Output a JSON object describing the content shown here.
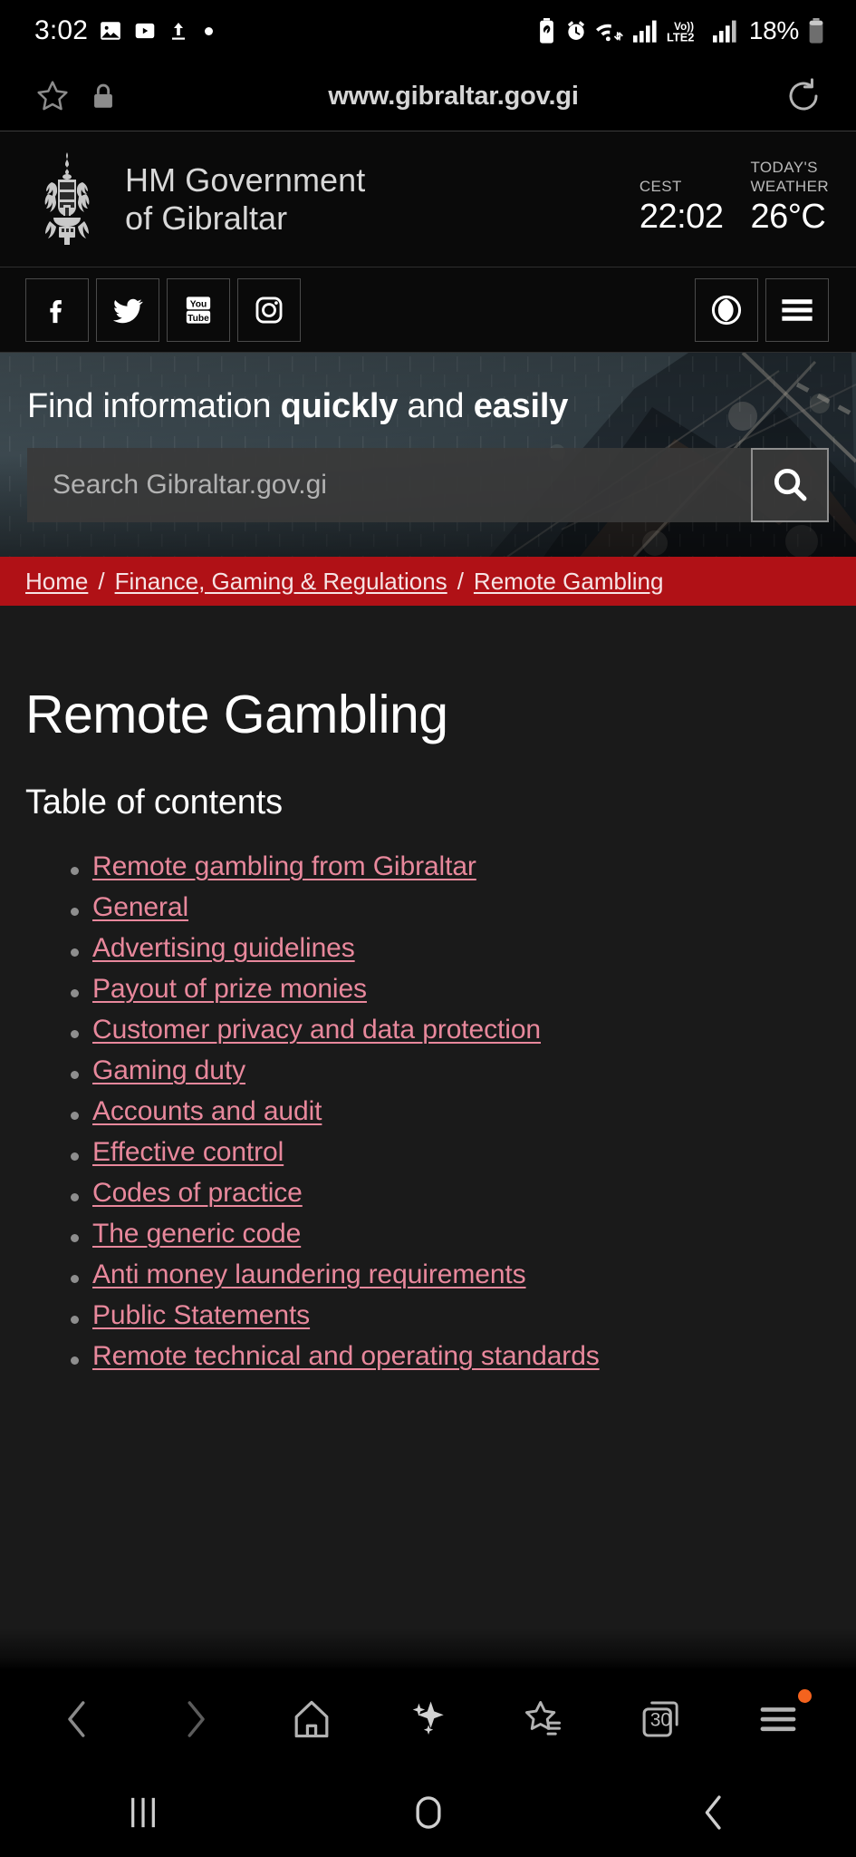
{
  "status_bar": {
    "clock": "3:02",
    "battery_percent": "18%",
    "network_label": "LTE2",
    "volte_label": "Vo))",
    "icons": [
      "photo-icon",
      "youtube-icon",
      "upload-icon",
      "status-dot",
      "battery-saver-icon",
      "alarm-icon",
      "wifi-icon",
      "signal-icon",
      "volte-icon",
      "signal2-icon",
      "battery-icon"
    ]
  },
  "browser": {
    "url": "www.gibraltar.gov.gi",
    "star_icon": "star-icon",
    "lock_icon": "lock-icon",
    "reload_icon": "reload-icon",
    "toolbar": {
      "back": "back-icon",
      "forward": "forward-icon",
      "home": "home-icon",
      "ai": "sparkle-icon",
      "bookmarks": "bookmarks-icon",
      "tabs_count": "30",
      "menu": "menu-icon",
      "menu_badge": true
    }
  },
  "android_nav": {
    "recents": "recents-icon",
    "home": "home-circle-icon",
    "back": "back-chevron-icon"
  },
  "site_header": {
    "crest": "gibraltar-coat-of-arms",
    "title_line1": "HM Government",
    "title_line2": "of Gibraltar",
    "timezone_label": "CEST",
    "time": "22:02",
    "weather_label_line1": "TODAY'S",
    "weather_label_line2": "WEATHER",
    "temperature": "26°C"
  },
  "social_bar": {
    "items": [
      {
        "name": "facebook-icon",
        "label": "Facebook"
      },
      {
        "name": "twitter-icon",
        "label": "Twitter"
      },
      {
        "name": "youtube-icon",
        "label": "YouTube"
      },
      {
        "name": "instagram-icon",
        "label": "Instagram"
      }
    ],
    "accessibility": {
      "name": "accessibility-eye-icon",
      "label": "Accessibility"
    },
    "menu": {
      "name": "hamburger-menu-icon",
      "label": "Menu"
    }
  },
  "hero": {
    "title_pre": "Find information ",
    "title_bold1": "quickly",
    "title_mid": " and ",
    "title_bold2": "easily",
    "search_placeholder": "Search Gibraltar.gov.gi",
    "search_value": "",
    "search_button_icon": "search-icon"
  },
  "breadcrumb": {
    "items": [
      "Home",
      "Finance, Gaming & Regulations",
      "Remote Gambling"
    ],
    "separator": "/"
  },
  "main": {
    "page_title": "Remote Gambling",
    "toc_heading": "Table of contents",
    "toc_items": [
      "Remote gambling from Gibraltar",
      "General",
      "Advertising guidelines",
      "Payout of prize monies",
      "Customer privacy and data protection",
      "Gaming duty",
      "Accounts and audit",
      "Effective control",
      "Codes of practice",
      "The generic code",
      "Anti money laundering requirements",
      "Public Statements",
      "Remote technical and operating standards"
    ]
  },
  "colors": {
    "breadcrumb_red": "#b01116",
    "link_pink": "#e8889c",
    "page_bg": "#1a1a1a",
    "header_bg": "#0a0a0a",
    "badge_orange": "#f4631e"
  }
}
